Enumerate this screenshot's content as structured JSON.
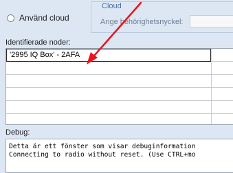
{
  "cloud_option": {
    "label": "Använd cloud"
  },
  "cloud_group": {
    "title": "Cloud",
    "key_label": "Ange behörighetsnyckel:",
    "key_value": ""
  },
  "nodes": {
    "label": "Identifierade noder:",
    "rows": [
      {
        "name": "'2995 IQ Box' - 2AFA"
      },
      {
        "name": ""
      },
      {
        "name": ""
      },
      {
        "name": ""
      },
      {
        "name": ""
      }
    ]
  },
  "debug": {
    "label": "Debug:",
    "lines": [
      "Detta är ett fönster som visar debuginformation",
      "Connecting to radio without reset. (Use CTRL+mo"
    ]
  },
  "annotation": {
    "arrow_color": "#e8141b"
  }
}
